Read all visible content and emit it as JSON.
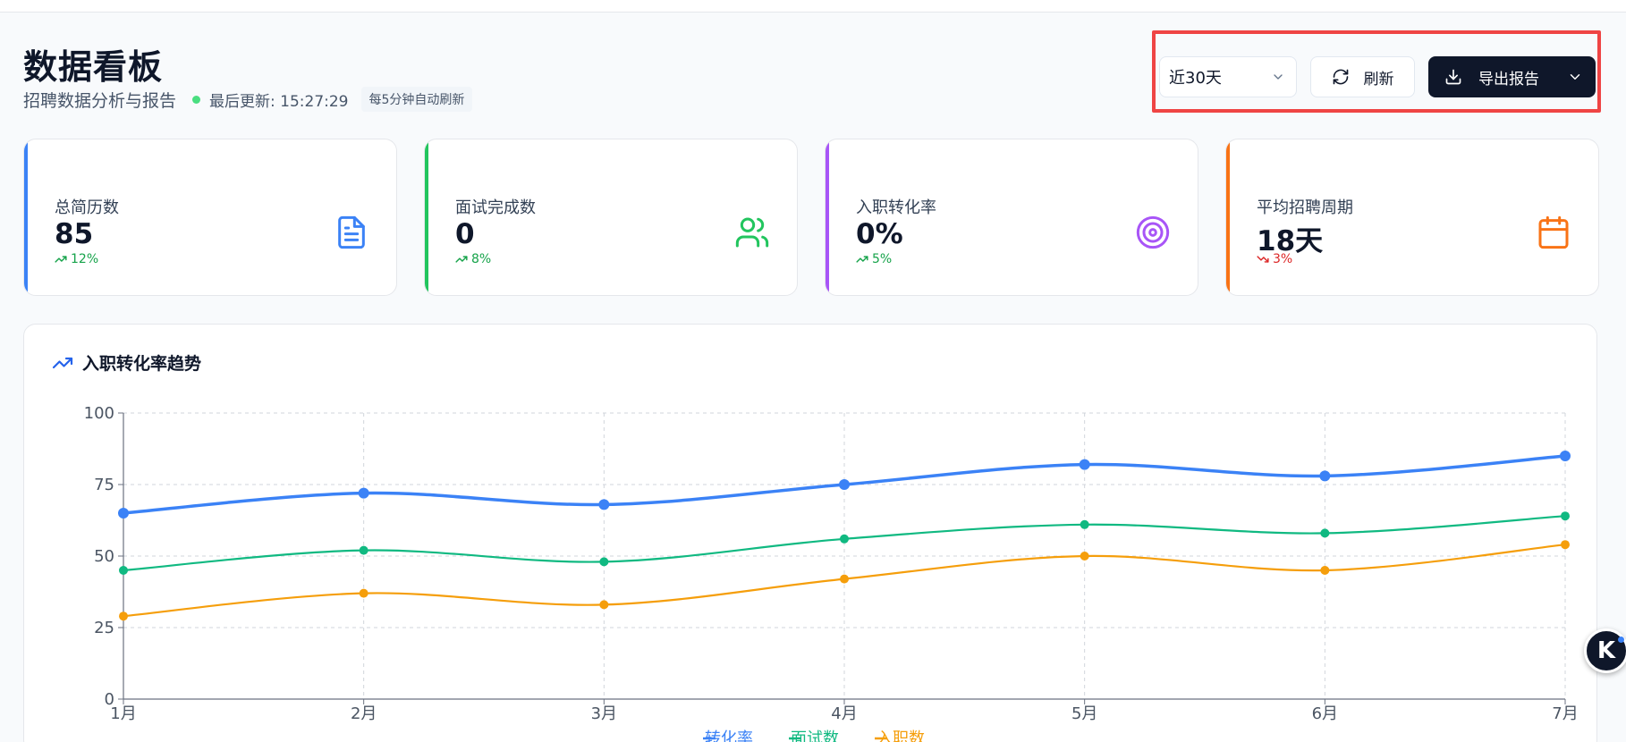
{
  "header": {
    "title": "数据看板",
    "subtitle": "招聘数据分析与报告",
    "last_updated": "最后更新: 15:27:29",
    "auto_refresh": "每5分钟自动刷新"
  },
  "toolbar": {
    "range_value": "近30天",
    "refresh_label": "刷新",
    "export_label": "导出报告"
  },
  "stats": [
    {
      "label": "总简历数",
      "value": "85",
      "trend": "12%",
      "direction": "up",
      "accent": "#3b82f6",
      "icon": "file-text-icon"
    },
    {
      "label": "面试完成数",
      "value": "0",
      "trend": "8%",
      "direction": "up",
      "accent": "#22c55e",
      "icon": "users-icon"
    },
    {
      "label": "入职转化率",
      "value": "0%",
      "trend": "5%",
      "direction": "up",
      "accent": "#a855f7",
      "icon": "target-icon"
    },
    {
      "label": "平均招聘周期",
      "value": "18天",
      "trend": "3%",
      "direction": "down",
      "accent": "#f97316",
      "icon": "calendar-icon"
    }
  ],
  "colors": {
    "trend_up": "#16a34a",
    "trend_down": "#dc2626"
  },
  "chart_title": "入职转化率趋势",
  "chart_data": {
    "type": "line",
    "categories": [
      "1月",
      "2月",
      "3月",
      "4月",
      "5月",
      "6月",
      "7月"
    ],
    "ylim": [
      0,
      100
    ],
    "yticks": [
      0,
      25,
      50,
      75,
      100
    ],
    "grid": true,
    "legend_position": "bottom",
    "series": [
      {
        "name": "转化率",
        "color": "#3b82f6",
        "values": [
          65,
          72,
          68,
          75,
          82,
          78,
          85
        ]
      },
      {
        "name": "面试数",
        "color": "#10b981",
        "values": [
          45,
          52,
          48,
          56,
          61,
          58,
          64
        ]
      },
      {
        "name": "入职数",
        "color": "#f59e0b",
        "values": [
          29,
          37,
          33,
          42,
          50,
          45,
          54
        ]
      }
    ]
  },
  "fab": {
    "label": "K"
  }
}
